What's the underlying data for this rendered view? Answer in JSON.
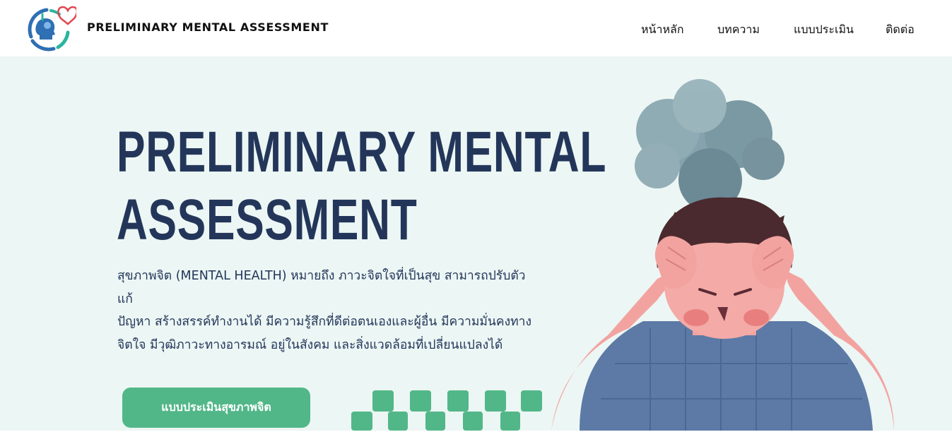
{
  "header": {
    "brand_title": "PRELIMINARY MENTAL ASSESSMENT",
    "logo_icon": "head-heart-logo-icon",
    "nav": [
      {
        "label": "หน้าหลัก"
      },
      {
        "label": "บทความ"
      },
      {
        "label": "แบบประเมิน"
      },
      {
        "label": "ติดต่อ"
      }
    ]
  },
  "hero": {
    "title_line1": "PRELIMINARY MENTAL",
    "title_line2": "ASSESSMENT",
    "description_line1": "สุขภาพจิต (MENTAL HEALTH) หมายถึง ภาวะจิตใจที่เป็นสุข สามารถปรับตัวแก้",
    "description_line2": "ปัญหา สร้างสรรค์ทำงานได้ มีความรู้สึกที่ดีต่อตนเองและผู้อื่น มีความมั่นคงทาง",
    "description_line3": "จิตใจ มีวุฒิภาวะทางอารมณ์ อยู่ในสังคม และสิ่งแวดล้อมที่เปลี่ยนแปลงได้",
    "cta_label": "แบบประเมินสุขภาพจิต",
    "illustration": "stressed-person-illustration"
  },
  "colors": {
    "hero_bg": "#ecf6f4",
    "title": "#23365a",
    "accent_green": "#52b788",
    "logo_blue": "#2f6fb3",
    "logo_teal": "#2bb5a0",
    "logo_red": "#e0464f"
  }
}
